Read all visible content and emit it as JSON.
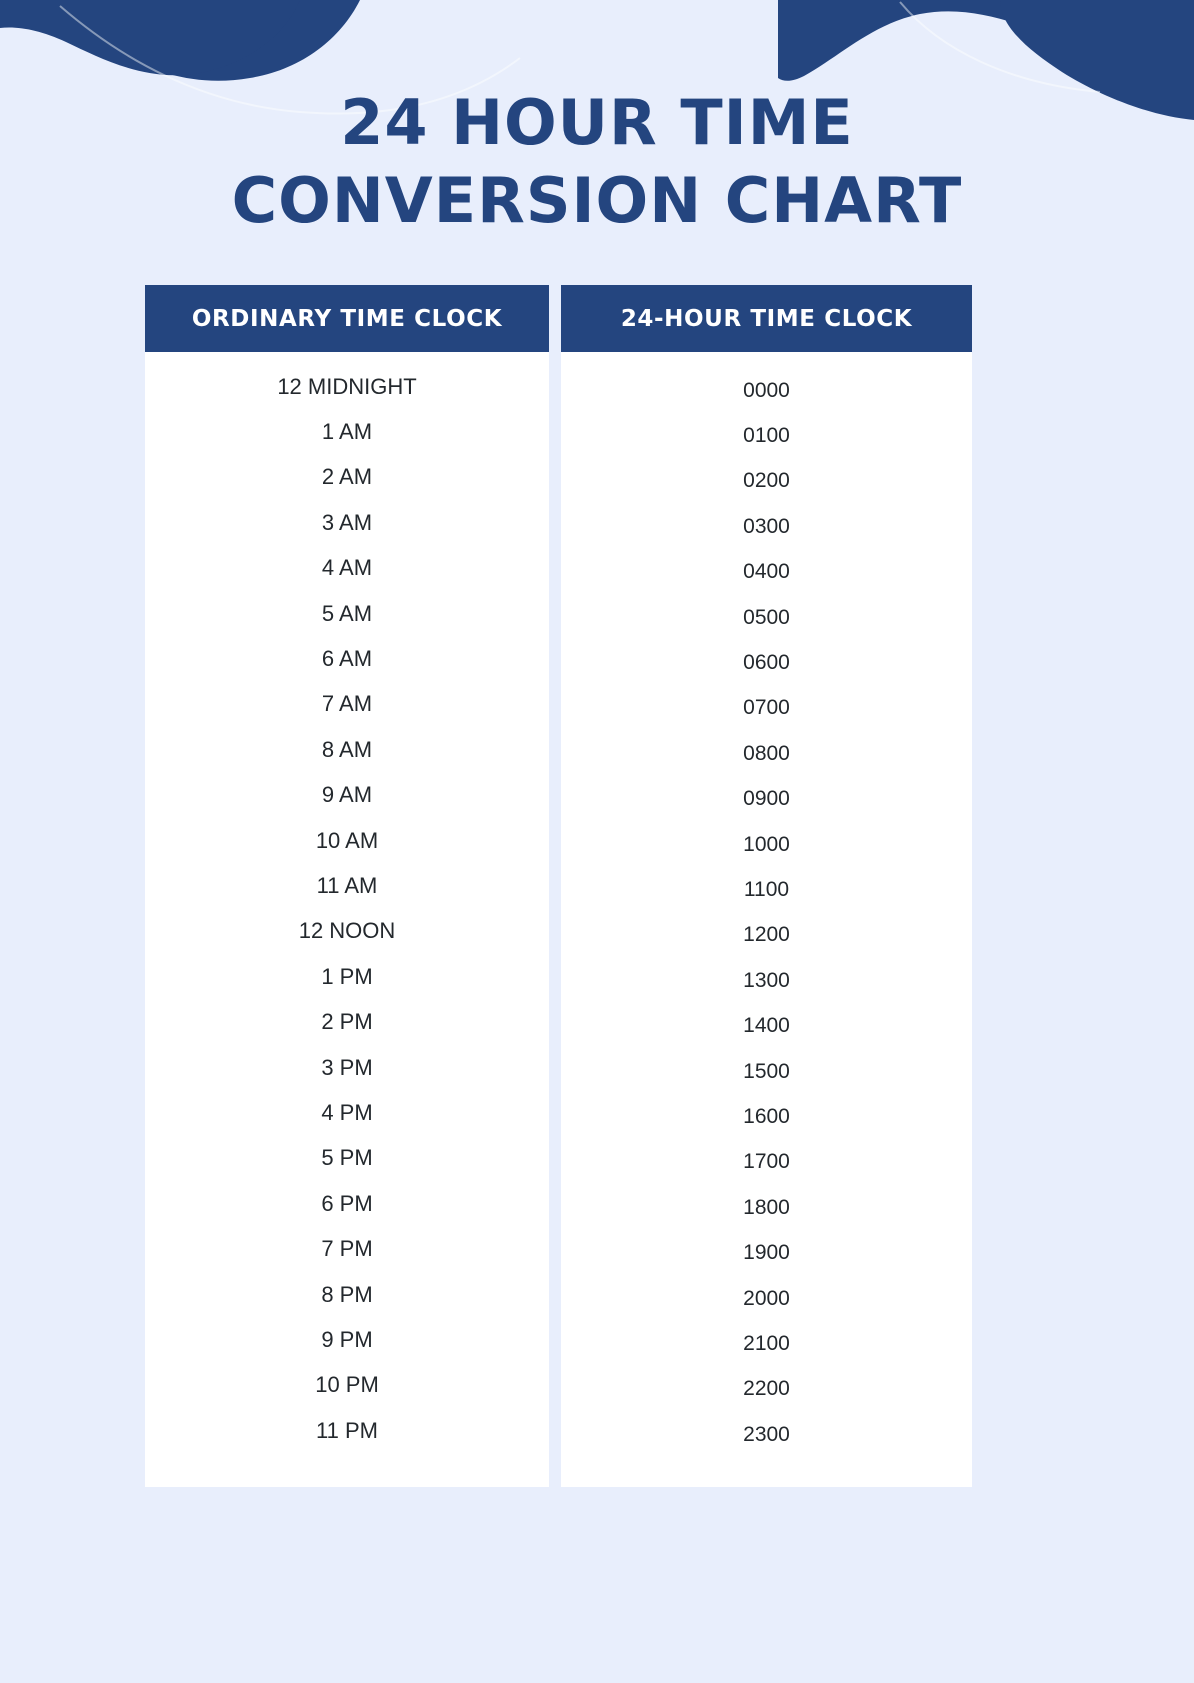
{
  "document": {
    "title_line1": "24 HOUR TIME",
    "title_line2": "CONVERSION CHART",
    "accent_color": "#24457f",
    "background_color": "#e8eefc",
    "table_background": "#ffffff"
  },
  "table": {
    "headers": [
      "ORDINARY TIME CLOCK",
      "24-HOUR TIME CLOCK"
    ],
    "rows": [
      {
        "ordinary": "12 MIDNIGHT",
        "military": "0000"
      },
      {
        "ordinary": "1 AM",
        "military": "0100"
      },
      {
        "ordinary": "2 AM",
        "military": "0200"
      },
      {
        "ordinary": "3 AM",
        "military": "0300"
      },
      {
        "ordinary": "4 AM",
        "military": "0400"
      },
      {
        "ordinary": "5 AM",
        "military": "0500"
      },
      {
        "ordinary": "6 AM",
        "military": "0600"
      },
      {
        "ordinary": "7 AM",
        "military": "0700"
      },
      {
        "ordinary": "8 AM",
        "military": "0800"
      },
      {
        "ordinary": "9 AM",
        "military": "0900"
      },
      {
        "ordinary": "10 AM",
        "military": "1000"
      },
      {
        "ordinary": "11 AM",
        "military": "1100"
      },
      {
        "ordinary": "12 NOON",
        "military": "1200"
      },
      {
        "ordinary": "1 PM",
        "military": "1300"
      },
      {
        "ordinary": "2 PM",
        "military": "1400"
      },
      {
        "ordinary": "3 PM",
        "military": "1500"
      },
      {
        "ordinary": "4 PM",
        "military": "1600"
      },
      {
        "ordinary": "5 PM",
        "military": "1700"
      },
      {
        "ordinary": "6 PM",
        "military": "1800"
      },
      {
        "ordinary": "7 PM",
        "military": "1900"
      },
      {
        "ordinary": "8 PM",
        "military": "2000"
      },
      {
        "ordinary": "9 PM",
        "military": "2100"
      },
      {
        "ordinary": "10 PM",
        "military": "2200"
      },
      {
        "ordinary": "11 PM",
        "military": "2300"
      }
    ]
  }
}
